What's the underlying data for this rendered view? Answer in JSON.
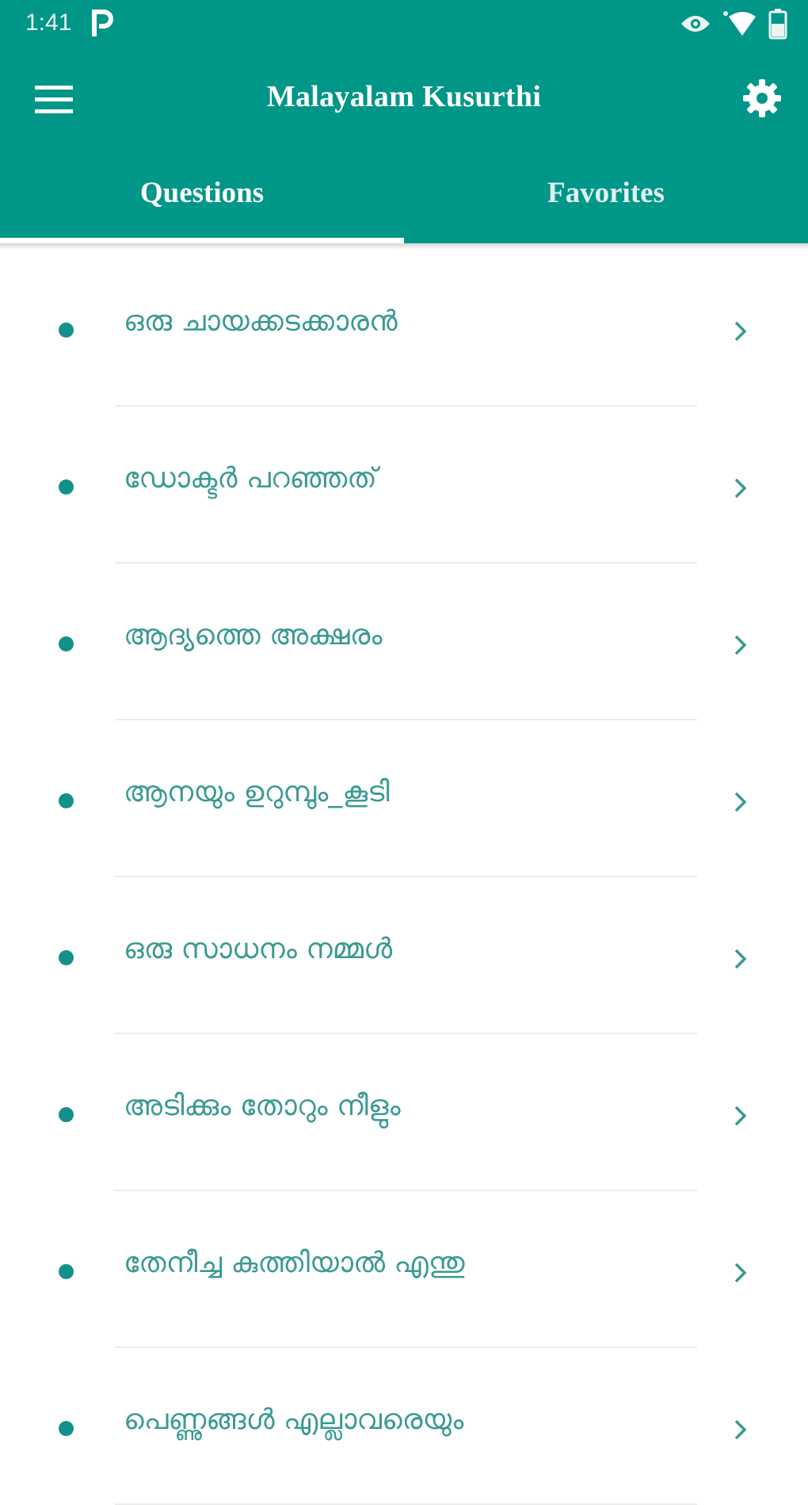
{
  "status_bar": {
    "time": "1:41",
    "left_icons": [
      "p-icon"
    ],
    "right_icons": [
      "eye-icon",
      "wifi-icon",
      "battery-icon"
    ]
  },
  "toolbar": {
    "title": "Malayalam Kusurthi",
    "menu_icon": "hamburger-menu-icon",
    "settings_icon": "gear-icon"
  },
  "tabs": [
    {
      "label": "Questions",
      "selected": true
    },
    {
      "label": "Favorites",
      "selected": false
    }
  ],
  "questions": [
    {
      "text": "ഒരു ചായക്കടക്കാരൻ"
    },
    {
      "text": "ഡോക്ടർ പറഞ്ഞത്"
    },
    {
      "text": "ആദ്യത്തെ അക്ഷരം"
    },
    {
      "text": "ആനയും ഉറുമ്പും_കൂടി"
    },
    {
      "text": "ഒരു സാധനം നമ്മൾ"
    },
    {
      "text": "അടിക്കും തോറും നീളും"
    },
    {
      "text": "തേനീച്ച കുത്തിയാൽ എന്തു"
    },
    {
      "text": "പെണ്ണുങ്ങൾ എല്ലാവരെയും"
    }
  ],
  "colors": {
    "primary": "#009688",
    "accent_text": "#3a9a93",
    "bullet": "#14908a",
    "divider": "#ececec"
  }
}
